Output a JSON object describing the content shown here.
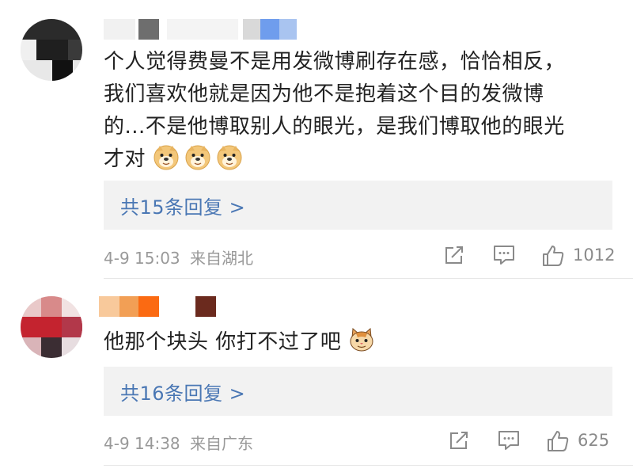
{
  "comments": [
    {
      "text_lines": [
        "个人觉得费曼不是用发微博刷存在感，恰恰相反，",
        "我们喜欢他就是因为他不是抱着这个目的发微博",
        "的...不是他博取别人的眼光，是我们博取他的眼光",
        "才对"
      ],
      "emojis": [
        "doge-emoji",
        "doge-emoji",
        "doge-emoji"
      ],
      "reply_label": "共15条回复 >",
      "timestamp": "4-9 15:03",
      "location": "来自湖北",
      "like_count": "1012"
    },
    {
      "text_lines": [
        "他那个块头 你打不过了吧"
      ],
      "emojis": [
        "cat-emoji"
      ],
      "reply_label": "共16条回复 >",
      "timestamp": "4-9 14:38",
      "location": "来自广东",
      "like_count": "625"
    }
  ],
  "colors": {
    "reply_link": "#4a77b4",
    "reply_bg": "#f2f2f2",
    "meta_text": "#999999"
  }
}
